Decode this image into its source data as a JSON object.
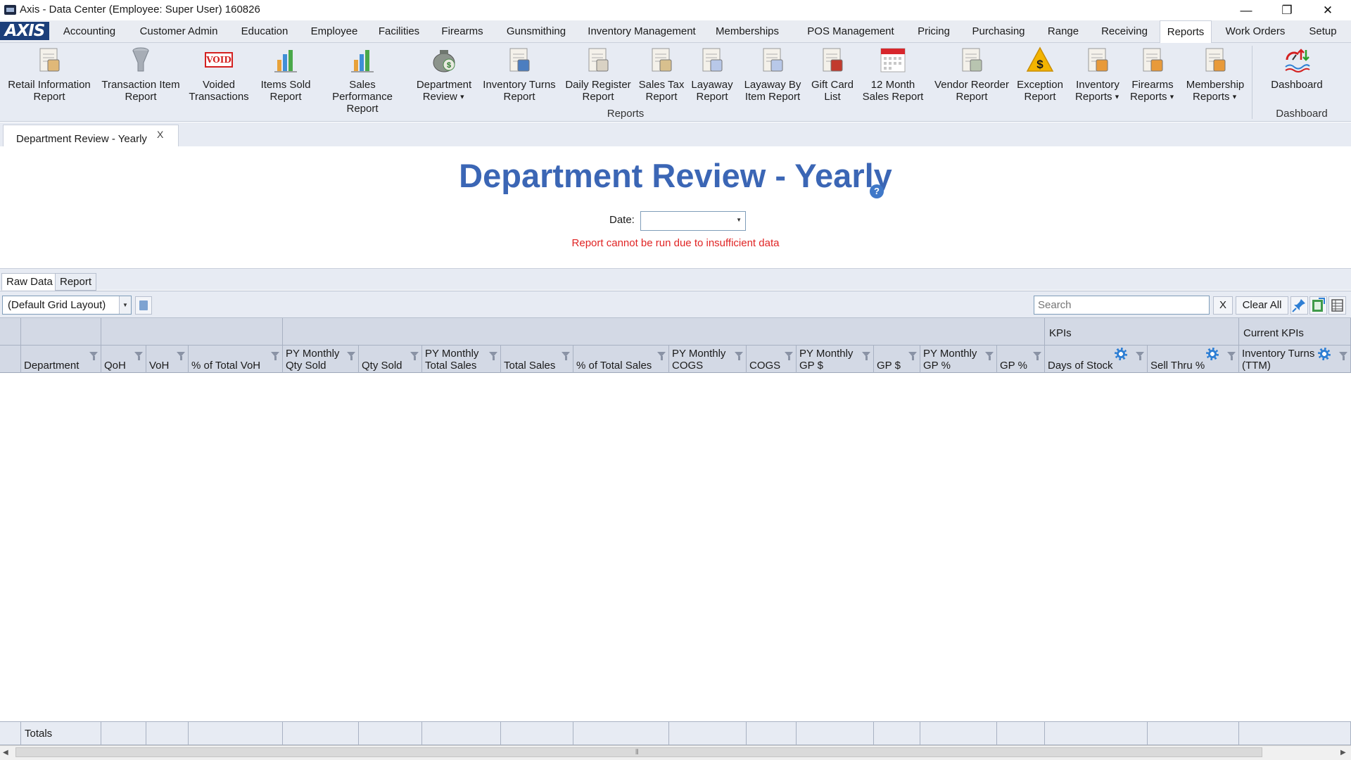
{
  "window": {
    "title": "Axis - Data Center  (Employee: Super User) 160826",
    "minimize": "—",
    "restore": "❐",
    "close": "✕"
  },
  "menubar": {
    "logo": "AXIS",
    "items": [
      "Accounting",
      "Customer Admin",
      "Education",
      "Employee",
      "Facilities",
      "Firearms",
      "Gunsmithing",
      "Inventory Management",
      "Memberships",
      "POS Management",
      "Pricing",
      "Purchasing",
      "Range",
      "Receiving",
      "Reports",
      "Work Orders",
      "Setup"
    ],
    "active": "Reports"
  },
  "ribbon": {
    "buttons": [
      {
        "label": "Retail Information\nReport",
        "icon": "report-doc-icon",
        "dropdown": false
      },
      {
        "label": "Transaction Item\nReport",
        "icon": "funnel-icon",
        "dropdown": false
      },
      {
        "label": "Voided\nTransactions",
        "icon": "void-stamp-icon",
        "icon_text": "VOID",
        "dropdown": false
      },
      {
        "label": "Items Sold\nReport",
        "icon": "bar-chart-icon",
        "dropdown": false
      },
      {
        "label": "Sales Performance\nReport",
        "icon": "performance-chart-icon",
        "dropdown": false
      },
      {
        "label": "Department\nReview",
        "icon": "money-bag-icon",
        "dropdown": true
      },
      {
        "label": "Inventory Turns\nReport",
        "icon": "inventory-turns-icon",
        "dropdown": false
      },
      {
        "label": "Daily Register\nReport",
        "icon": "register-doc-icon",
        "dropdown": false
      },
      {
        "label": "Sales Tax\nReport",
        "icon": "tax-doc-icon",
        "dropdown": false
      },
      {
        "label": "Layaway\nReport",
        "icon": "layaway-doc-icon",
        "dropdown": false
      },
      {
        "label": "Layaway By\nItem Report",
        "icon": "layaway-item-doc-icon",
        "dropdown": false
      },
      {
        "label": "Gift Card\nList",
        "icon": "gift-card-icon",
        "dropdown": false
      },
      {
        "label": "12 Month\nSales Report",
        "icon": "calendar-icon",
        "dropdown": false
      },
      {
        "label": "Vendor Reorder\nReport",
        "icon": "vendor-reorder-icon",
        "dropdown": false
      },
      {
        "label": "Exception\nReport",
        "icon": "dollar-warning-icon",
        "dropdown": false
      },
      {
        "label": "Inventory\nReports",
        "icon": "inventory-reports-icon",
        "dropdown": true
      },
      {
        "label": "Firearms\nReports",
        "icon": "firearms-reports-icon",
        "dropdown": true
      },
      {
        "label": "Membership\nReports",
        "icon": "membership-reports-icon",
        "dropdown": true
      },
      {
        "label": "Dashboard",
        "icon": "dashboard-gauge-icon",
        "dropdown": false
      }
    ],
    "group_reports": "Reports",
    "group_dashboard": "Dashboard"
  },
  "doc_tab": {
    "label": "Department Review - Yearly",
    "close": "X"
  },
  "report": {
    "title": "Department Review - Yearly",
    "help": "?",
    "date_label": "Date:",
    "date_value": "",
    "error": "Report cannot be run due to insufficient data"
  },
  "view_tabs": [
    "Raw Data",
    "Report"
  ],
  "active_view_tab": "Raw Data",
  "toolbar": {
    "layout_value": "(Default Grid Layout)",
    "search_placeholder": "Search",
    "search_clear": "X",
    "clear_all": "Clear All"
  },
  "grid": {
    "bands": [
      {
        "label": ""
      },
      {
        "label": ""
      },
      {
        "label": ""
      },
      {
        "label": "KPIs"
      },
      {
        "label": "Current KPIs"
      }
    ],
    "columns": [
      {
        "label": "Department",
        "gear": false
      },
      {
        "label": "QoH",
        "gear": false
      },
      {
        "label": "VoH",
        "gear": false
      },
      {
        "label": "% of Total VoH",
        "gear": false
      },
      {
        "label": "PY Monthly\nQty Sold",
        "gear": false
      },
      {
        "label": "Qty Sold",
        "gear": false
      },
      {
        "label": "PY Monthly\nTotal Sales",
        "gear": false
      },
      {
        "label": "Total Sales",
        "gear": false
      },
      {
        "label": "% of Total Sales",
        "gear": false
      },
      {
        "label": "PY Monthly\nCOGS",
        "gear": false
      },
      {
        "label": "COGS",
        "gear": false
      },
      {
        "label": "PY Monthly\nGP $",
        "gear": false
      },
      {
        "label": "GP $",
        "gear": false
      },
      {
        "label": "PY Monthly\nGP %",
        "gear": false
      },
      {
        "label": "GP %",
        "gear": false
      },
      {
        "label": "Days of Stock",
        "gear": true
      },
      {
        "label": "Sell Thru %",
        "gear": true
      },
      {
        "label": "Inventory Turns\n(TTM)",
        "gear": true
      }
    ],
    "rows": [],
    "totals_label": "Totals"
  },
  "colors": {
    "accent": "#3b66b5",
    "error": "#e02424",
    "header": "#d3d9e5",
    "ribbon": "#e7ebf3"
  }
}
